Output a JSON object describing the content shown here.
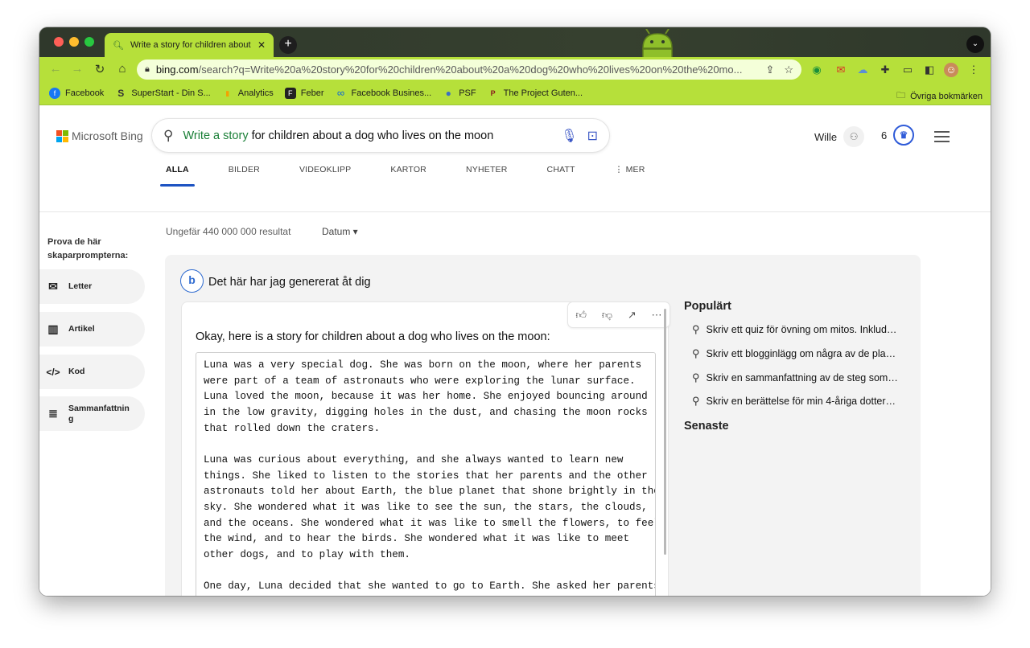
{
  "browser": {
    "tab_title": "Write a story for children about",
    "url_host": "bing.com",
    "url_path": "/search?q=Write%20a%20story%20for%20children%20about%20a%20dog%20who%20lives%20on%20the%20mo...",
    "tab_close": "✕",
    "new_tab": "+"
  },
  "bookmarks": [
    {
      "label": "Facebook",
      "color": "#1877f2",
      "glyph": "f"
    },
    {
      "label": "SuperStart - Din S...",
      "color": "#444444",
      "glyph": "S"
    },
    {
      "label": "Analytics",
      "color": "#f4a100",
      "glyph": "▮"
    },
    {
      "label": "Feber",
      "color": "#222222",
      "glyph": "F"
    },
    {
      "label": "Facebook Busines...",
      "color": "#0a66d8",
      "glyph": "∞"
    },
    {
      "label": "PSF",
      "color": "#3b6fc2",
      "glyph": "●"
    },
    {
      "label": "The Project Guten...",
      "color": "#8a1d1d",
      "glyph": "P"
    }
  ],
  "bookmarks_other": "Övriga bokmärken",
  "bing": {
    "logo_text": "Microsoft Bing",
    "query_highlight": "Write a story",
    "query_rest": " for children about a dog who lives on the moon",
    "user_name": "Wille",
    "points": "6"
  },
  "nav_tabs": [
    "ALLA",
    "BILDER",
    "VIDEOKLIPP",
    "KARTOR",
    "NYHETER",
    "CHATT",
    "⋮ MER"
  ],
  "results_info": "Ungefär 440 000 000 resultat",
  "date_filter": "Datum ▾",
  "sidebar": {
    "title": "Prova de här skaparpromptерna:",
    "items": [
      {
        "label": "Letter",
        "icon": "✉"
      },
      {
        "label": "Artikel",
        "icon": "▥"
      },
      {
        "label": "Kod",
        "icon": "</>"
      },
      {
        "label": "Sammanfattning",
        "icon": "≣"
      }
    ]
  },
  "answer": {
    "header": "Det här har jag genererat åt dig",
    "intro": "Okay, here is a story for children about a dog who lives on the moon:",
    "story": "Luna was a very special dog. She was born on the moon, where her parents\nwere part of a team of astronauts who were exploring the lunar surface.\nLuna loved the moon, because it was her home. She enjoyed bouncing around\nin the low gravity, digging holes in the dust, and chasing the moon rocks\nthat rolled down the craters.\n\nLuna was curious about everything, and she always wanted to learn new\nthings. She liked to listen to the stories that her parents and the other\nastronauts told her about Earth, the blue planet that shone brightly in the\nsky. She wondered what it was like to see the sun, the stars, the clouds,\nand the oceans. She wondered what it was like to smell the flowers, to feel\nthe wind, and to hear the birds. She wondered what it was like to meet\nother dogs, and to play with them.\n\nOne day, Luna decided that she wanted to go to Earth. She asked her parents\nif they could take her with them on their next mission, but they said no.\nThey said that Earth was too dangerous for a moon dog, and that she would"
  },
  "popular": {
    "title": "Populärt",
    "items": [
      "Skriv ett quiz för övning om mitos. Inklud…",
      "Skriv ett blogginlägg om några av de pla…",
      "Skriv en sammanfattning av de steg som…",
      "Skriv en berättelse för min 4-åriga dotter…"
    ]
  },
  "latest_title": "Senaste"
}
